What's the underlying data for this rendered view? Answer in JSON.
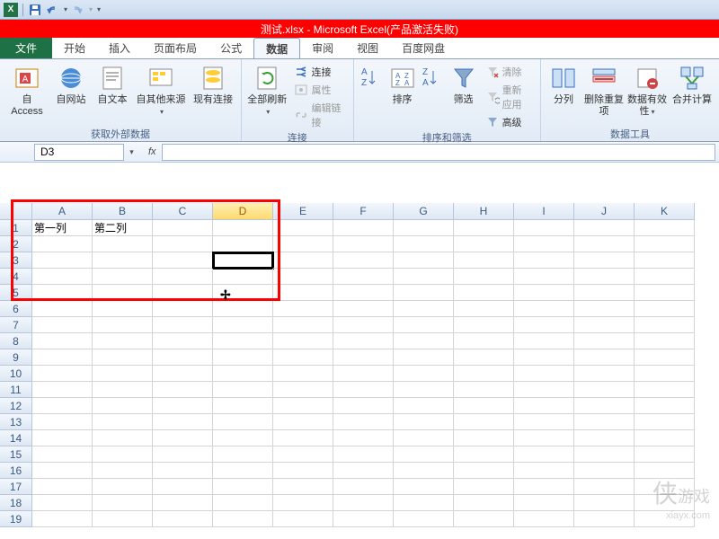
{
  "app": {
    "title_doc": "测试.xlsx",
    "title_app": "Microsoft Excel(产品激活失败)"
  },
  "qat": {
    "save": "保存",
    "undo": "撤消",
    "redo": "恢复"
  },
  "tabs": [
    "文件",
    "开始",
    "插入",
    "页面布局",
    "公式",
    "数据",
    "审阅",
    "视图",
    "百度网盘"
  ],
  "active_tab_index": 5,
  "ribbon": {
    "g1": {
      "label": "获取外部数据",
      "access": "自 Access",
      "web": "自网站",
      "text": "自文本",
      "other": "自其他来源",
      "existing": "现有连接"
    },
    "g2": {
      "label": "连接",
      "refresh": "全部刷新",
      "conn": "连接",
      "props": "属性",
      "edit": "编辑链接"
    },
    "g3": {
      "label": "排序和筛选",
      "sort": "排序",
      "filter": "筛选",
      "clear": "清除",
      "reapply": "重新应用",
      "advanced": "高级"
    },
    "g4": {
      "label": "数据工具",
      "t2c": "分列",
      "dedup": "删除重复项",
      "valid": "数据有效性",
      "consol": "合并计算"
    }
  },
  "namebox": "D3",
  "columns": [
    "A",
    "B",
    "C",
    "D",
    "E",
    "F",
    "G",
    "H",
    "I",
    "J",
    "K"
  ],
  "cells": {
    "A1": "第一列",
    "B1": "第二列"
  },
  "selected": "D3",
  "row_count": 19,
  "watermark": {
    "main": "侠",
    "sub1": "游戏",
    "sub2": "xiayx.com"
  }
}
